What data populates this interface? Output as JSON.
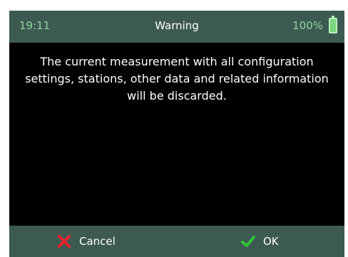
{
  "status": {
    "time": "19:11",
    "title": "Warning",
    "battery": "100%",
    "battery_icon": "battery-full-icon"
  },
  "main": {
    "message": "The current measurement with all configuration settings, stations, other data and related information will be discarded."
  },
  "footer": {
    "cancel_label": "Cancel",
    "ok_label": "OK",
    "cancel_icon": "close-icon",
    "ok_icon": "check-icon"
  },
  "colors": {
    "bar_bg": "#3d5a52",
    "accent_green": "#8fd59c",
    "cancel_red": "#e1262b",
    "ok_green": "#31c33a"
  }
}
